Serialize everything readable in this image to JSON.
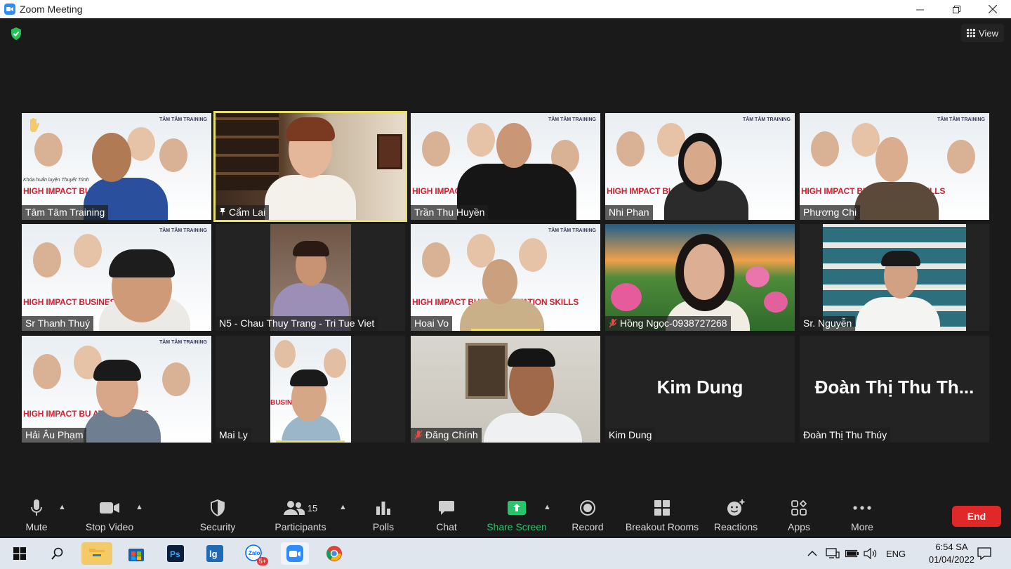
{
  "window": {
    "title": "Zoom Meeting"
  },
  "header": {
    "view_label": "View"
  },
  "participants_tiles": [
    {
      "name": "Tâm Tâm Training",
      "banner_sub": "Khóa huấn luyện Thuyết Trình",
      "banner_title": "HIGH IMPACT BUSI       TATION SKILLS"
    },
    {
      "name": "Cẩm Lai"
    },
    {
      "name": "Trần Thu Huyền",
      "banner_title": "HIGH IMPACT BUS"
    },
    {
      "name": "Nhi Phan",
      "banner_title": "HIGH IMPACT BU        TION SKILLS"
    },
    {
      "name": "Phương Chi",
      "banner_title": "HIGH IMPACT BUSI       NTATION SKILLS"
    },
    {
      "name": "Sr Thanh Thuý",
      "banner_title": "HIGH IMPACT BUSINESS"
    },
    {
      "name": "N5 - Chau Thuy Trang - Tri Tue Viet"
    },
    {
      "name": "Hoai Vo",
      "banner_title": "HIGH IMPACT BUSI     RESENTATION SKILLS"
    },
    {
      "name": "Hồng Ngọc-0938727268"
    },
    {
      "name": "Sr. Nguyễn"
    },
    {
      "name": "Hải Âu Phạm",
      "banner_title": "HIGH IMPACT BU         ATION SKILLS"
    },
    {
      "name": "Mai Ly"
    },
    {
      "name": "Đăng Chính"
    },
    {
      "name": "Kim Dung",
      "big_name": "Kim Dung"
    },
    {
      "name": "Đoàn Thị Thu Thúy",
      "big_name": "Đoàn Thị Thu Th..."
    }
  ],
  "banner_logo": "TÂM TÂM TRAINING",
  "toolbar": {
    "mute": "Mute",
    "stop_video": "Stop Video",
    "security": "Security",
    "participants": "Participants",
    "participants_count": "15",
    "polls": "Polls",
    "chat": "Chat",
    "share_screen": "Share Screen",
    "record": "Record",
    "breakout_rooms": "Breakout Rooms",
    "reactions": "Reactions",
    "apps": "Apps",
    "more": "More",
    "end": "End"
  },
  "taskbar": {
    "language": "ENG",
    "time": "6:54 SA",
    "date": "01/04/2022",
    "zalo_badge": "5+"
  },
  "colors": {
    "accent": "#2d8cff",
    "active_speaker": "#e8e06a",
    "share_green": "#27c46b",
    "end_red": "#e02828"
  }
}
